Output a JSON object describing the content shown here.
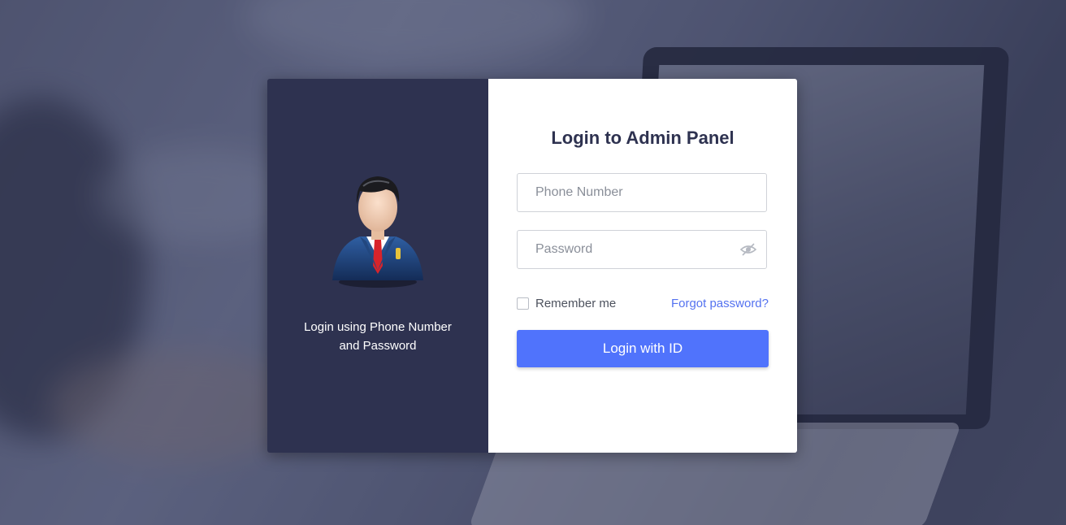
{
  "left_panel": {
    "caption_line1": "Login using Phone Number",
    "caption_line2": "and Password",
    "avatar_icon": "businessman-avatar-icon"
  },
  "form": {
    "title": "Login to Admin Panel",
    "phone_placeholder": "Phone Number",
    "phone_value": "",
    "password_placeholder": "Password",
    "password_value": "",
    "toggle_icon": "eye-slash-icon",
    "remember_label": "Remember me",
    "remember_checked": false,
    "forgot_link": "Forgot password?",
    "submit_label": "Login with ID"
  },
  "colors": {
    "left_panel_bg": "#2e3250",
    "accent": "#5073fc",
    "link": "#5472f0",
    "title": "#2e3250"
  }
}
